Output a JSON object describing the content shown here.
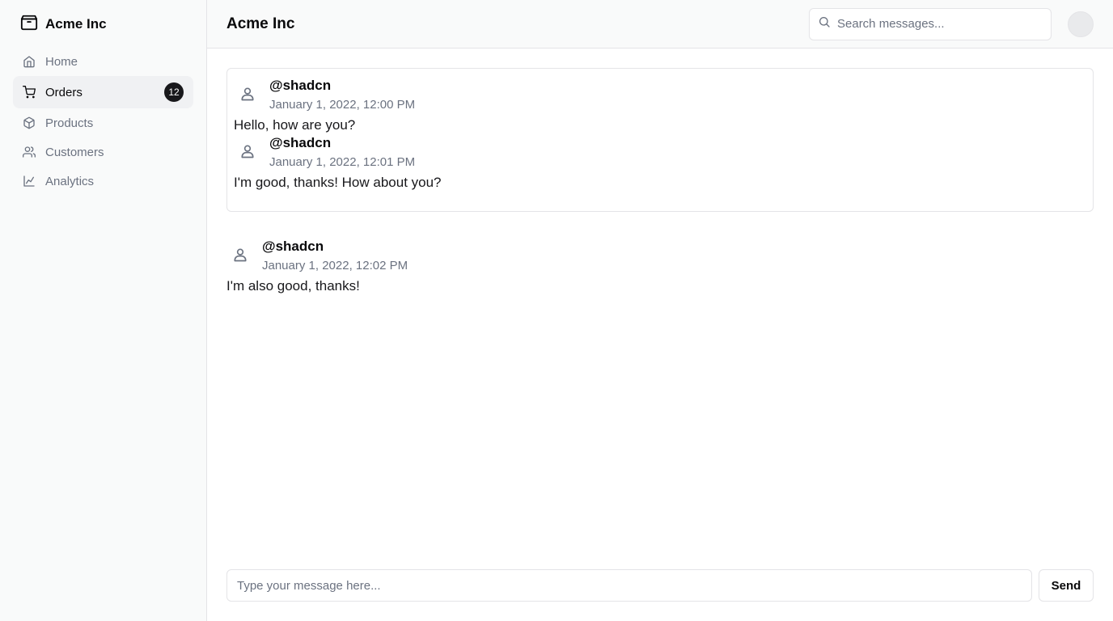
{
  "brand": {
    "name": "Acme Inc",
    "icon": "package-icon"
  },
  "sidebar": {
    "items": [
      {
        "label": "Home",
        "icon": "home-icon"
      },
      {
        "label": "Orders",
        "icon": "cart-icon",
        "badge": "12",
        "active": true
      },
      {
        "label": "Products",
        "icon": "package-icon"
      },
      {
        "label": "Customers",
        "icon": "users-icon"
      },
      {
        "label": "Analytics",
        "icon": "line-chart-icon"
      }
    ]
  },
  "header": {
    "title": "Acme Inc",
    "search_placeholder": "Search messages..."
  },
  "messages": [
    {
      "user": "@shadcn",
      "time": "January 1, 2022, 12:00 PM",
      "text": "Hello, how are you?"
    },
    {
      "user": "@shadcn",
      "time": "January 1, 2022, 12:01 PM",
      "text": "I'm good, thanks! How about you?"
    },
    {
      "user": "@shadcn",
      "time": "January 1, 2022, 12:02 PM",
      "text": "I'm also good, thanks!"
    }
  ],
  "composer": {
    "placeholder": "Type your message here...",
    "send_label": "Send"
  },
  "colors": {
    "accent": "#18181b",
    "muted_text": "#6b7280",
    "sidebar_bg": "#f9fafa",
    "border": "#e4e4e7"
  }
}
